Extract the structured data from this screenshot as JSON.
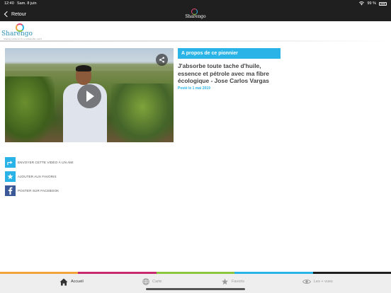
{
  "status_bar": {
    "time": "12:40",
    "date": "Sam. 8 juin",
    "battery": "99 %"
  },
  "nav": {
    "back_label": "Retour",
    "logo_text": "Sharengo"
  },
  "brand": {
    "logo_text": "Sharengo",
    "tagline": "Sharing solutions for a sustainable world"
  },
  "video": {
    "share_icon": "share-icon",
    "play_icon": "play-icon"
  },
  "about": {
    "header": "A propos de ce pionnier",
    "title": "J'absorbe toute tache d'huile, essence et pétrole avec ma fibre écologique - Jose Carlos Vargas",
    "posted": "Posté le 1 mai 2019"
  },
  "actions": [
    {
      "label": "ENVOYER CETTE VIDÉO À UN AMI",
      "icon": "share-arrow-icon"
    },
    {
      "label": "AJOUTER AUX FAVORIS",
      "icon": "star-icon"
    },
    {
      "label": "POSTER SUR FACEBOOK",
      "icon": "facebook-icon"
    }
  ],
  "tabs": [
    {
      "label": "Accueil",
      "icon": "home-icon",
      "active": true
    },
    {
      "label": "Carte",
      "icon": "globe-icon",
      "active": false
    },
    {
      "label": "Favoris",
      "icon": "star-icon",
      "active": false
    },
    {
      "label": "Les + vues",
      "icon": "eye-icon",
      "active": false
    }
  ],
  "colors": {
    "accent": "#29b3e6",
    "facebook": "#3b5998",
    "tab_bar_stripes": [
      "#f2a33a",
      "#c72b6e",
      "#8bc540",
      "#29b3e6",
      "#1f1f1f"
    ]
  }
}
